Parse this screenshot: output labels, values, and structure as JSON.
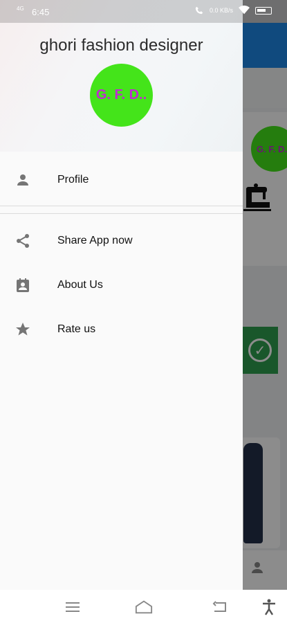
{
  "status_bar": {
    "network": "4G",
    "time": "6:45",
    "speed": "0.0 KB/s",
    "battery": "80"
  },
  "drawer": {
    "title": "ghori fashion designer",
    "logo_text": "G. F. D..",
    "items": [
      {
        "label": "Profile",
        "icon": "person-icon"
      },
      {
        "label": "Share App now",
        "icon": "share-icon"
      },
      {
        "label": "About Us",
        "icon": "contact-card-icon"
      },
      {
        "label": "Rate us",
        "icon": "star-icon"
      }
    ]
  },
  "background": {
    "logo_text": "G. F. D.."
  },
  "nav_bar": {
    "buttons": [
      "menu-icon",
      "home-icon",
      "back-icon",
      "accessibility-icon"
    ]
  },
  "colors": {
    "accent": "#1e88e5",
    "logo_bg": "#44e41a",
    "logo_text": "#c02bd2",
    "icon_gray": "#757575"
  }
}
